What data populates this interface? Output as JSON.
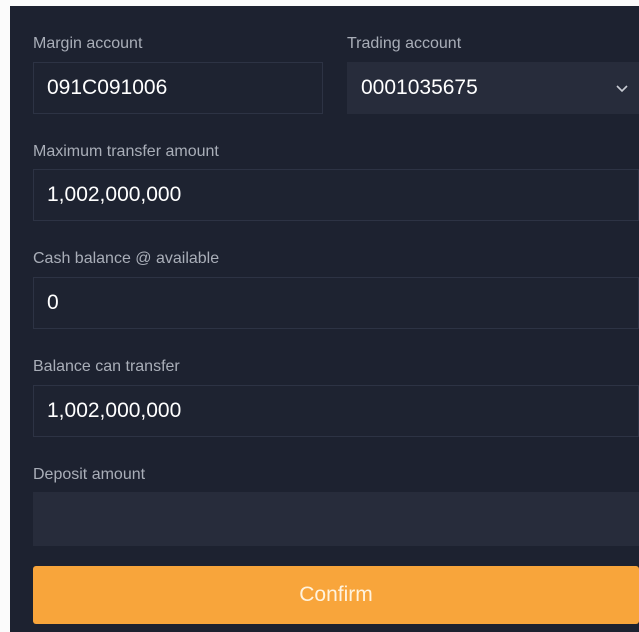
{
  "margin_account": {
    "label": "Margin account",
    "value": "091C091006"
  },
  "trading_account": {
    "label": "Trading account",
    "value": "0001035675",
    "icon": "chevron-down-icon"
  },
  "max_transfer": {
    "label": "Maximum transfer amount",
    "value": "1,002,000,000"
  },
  "cash_balance": {
    "label": "Cash balance @ available",
    "value": "0"
  },
  "balance_transfer": {
    "label": "Balance can transfer",
    "value": "1,002,000,000"
  },
  "deposit": {
    "label": "Deposit amount",
    "value": ""
  },
  "confirm": {
    "label": "Confirm"
  },
  "colors": {
    "panel": "#1d2230",
    "field_bg": "#272c3b",
    "label": "#a9aeb8",
    "accent": "#f8a53b"
  }
}
